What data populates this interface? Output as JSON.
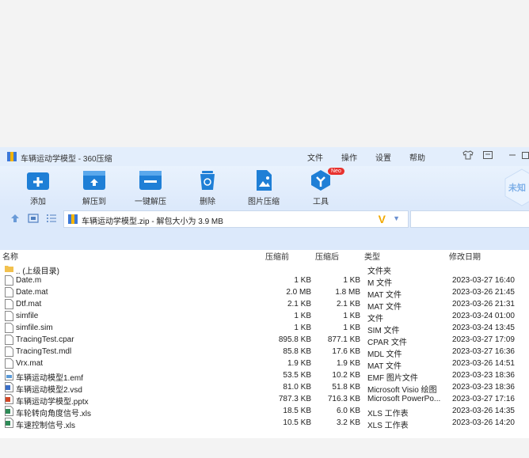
{
  "window": {
    "title": "车辆运动学模型 - 360压缩",
    "menu": [
      "文件",
      "操作",
      "设置",
      "帮助"
    ],
    "window_buttons": [
      "shirt-icon",
      "message-icon",
      "minimize-icon"
    ]
  },
  "toolbar": {
    "items": [
      {
        "label": "添加",
        "icon": "add-icon"
      },
      {
        "label": "解压到",
        "icon": "extract-to-icon"
      },
      {
        "label": "一键解压",
        "icon": "one-click-extract-icon"
      },
      {
        "label": "删除",
        "icon": "delete-icon"
      },
      {
        "label": "图片压缩",
        "icon": "image-compress-icon"
      },
      {
        "label": "工具",
        "icon": "tools-icon",
        "badge": "Neo"
      }
    ],
    "side_label": "未知"
  },
  "address": {
    "path": "车辆运动学模型.zip - 解包大小为 3.9 MB",
    "search_placeholder": ""
  },
  "columns": {
    "name": "名称",
    "size": "压缩前",
    "compressed": "压缩后",
    "type": "类型",
    "modified": "修改日期"
  },
  "files": [
    {
      "name": ".. (上级目录)",
      "size": "",
      "compressed": "",
      "type": "文件夹",
      "modified": "",
      "icon": "folder"
    },
    {
      "name": "Date.m",
      "size": "1 KB",
      "compressed": "1 KB",
      "type": "M 文件",
      "modified": "2023-03-27 16:40",
      "icon": "file"
    },
    {
      "name": "Date.mat",
      "size": "2.0 MB",
      "compressed": "1.8 MB",
      "type": "MAT 文件",
      "modified": "2023-03-26 21:45",
      "icon": "file"
    },
    {
      "name": "Dtf.mat",
      "size": "2.1 KB",
      "compressed": "2.1 KB",
      "type": "MAT 文件",
      "modified": "2023-03-26 21:31",
      "icon": "file"
    },
    {
      "name": "simfile",
      "size": "1 KB",
      "compressed": "1 KB",
      "type": "文件",
      "modified": "2023-03-24 01:00",
      "icon": "file"
    },
    {
      "name": "simfile.sim",
      "size": "1 KB",
      "compressed": "1 KB",
      "type": "SIM 文件",
      "modified": "2023-03-24 13:45",
      "icon": "file"
    },
    {
      "name": "TracingTest.cpar",
      "size": "895.8 KB",
      "compressed": "877.1 KB",
      "type": "CPAR 文件",
      "modified": "2023-03-27 17:09",
      "icon": "file"
    },
    {
      "name": "TracingTest.mdl",
      "size": "85.8 KB",
      "compressed": "17.6 KB",
      "type": "MDL 文件",
      "modified": "2023-03-27 16:36",
      "icon": "file"
    },
    {
      "name": "Vrx.mat",
      "size": "1.9 KB",
      "compressed": "1.9 KB",
      "type": "MAT 文件",
      "modified": "2023-03-26 14:51",
      "icon": "file"
    },
    {
      "name": "车辆运动模型1.emf",
      "size": "53.5 KB",
      "compressed": "10.2 KB",
      "type": "EMF 图片文件",
      "modified": "2023-03-23 18:36",
      "icon": "emf"
    },
    {
      "name": "车辆运动模型2.vsd",
      "size": "81.0 KB",
      "compressed": "51.8 KB",
      "type": "Microsoft Visio 绘图",
      "modified": "2023-03-23 18:36",
      "icon": "vsd"
    },
    {
      "name": "车辆运动学模型.pptx",
      "size": "787.3 KB",
      "compressed": "716.3 KB",
      "type": "Microsoft PowerPo...",
      "modified": "2023-03-27 17:16",
      "icon": "pptx"
    },
    {
      "name": "车轮转向角度信号.xls",
      "size": "18.5 KB",
      "compressed": "6.0 KB",
      "type": "XLS 工作表",
      "modified": "2023-03-26 14:35",
      "icon": "xls"
    },
    {
      "name": "车速控制信号.xls",
      "size": "10.5 KB",
      "compressed": "3.2 KB",
      "type": "XLS 工作表",
      "modified": "2023-03-26 14:20",
      "icon": "xls"
    }
  ]
}
